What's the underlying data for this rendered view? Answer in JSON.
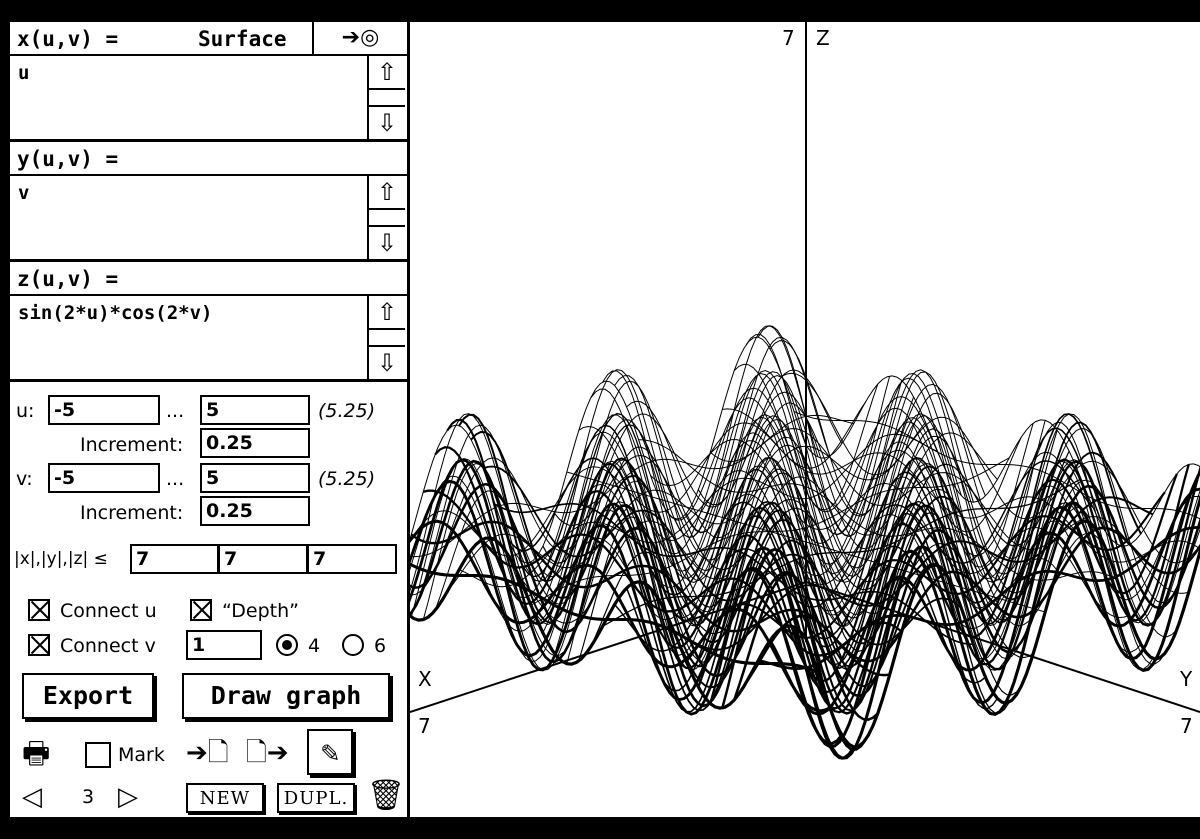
{
  "panel": {
    "x_label": "x(u,v) =",
    "mode_label": "Surface",
    "mode_button": "➔◎",
    "x_expr": "u",
    "y_label": "y(u,v) =",
    "y_expr": "v",
    "z_label": "z(u,v) =",
    "z_expr": "sin(2*u)*cos(2*v)",
    "u_label": "u:",
    "u_min": "-5",
    "u_max": "5",
    "u_note": "(5.25)",
    "u_inc_label": "Increment:",
    "u_inc": "0.25",
    "v_label": "v:",
    "v_min": "-5",
    "v_max": "5",
    "v_note": "(5.25)",
    "v_inc_label": "Increment:",
    "v_inc": "0.25",
    "ellipsis": "...",
    "bounds_label": "|x|,|y|,|z| ≤",
    "bound_x": "7",
    "bound_y": "7",
    "bound_z": "7",
    "connect_u": "Connect u",
    "depth": "“Depth”",
    "connect_v": "Connect v",
    "depth_value": "1",
    "radio_4": "4",
    "radio_6": "6",
    "export": "Export",
    "draw": "Draw graph",
    "mark": "Mark",
    "page": "3",
    "new": "NEW",
    "dupl": "DUPL."
  },
  "plot": {
    "z_axis_label": "Z",
    "z_tick": "7",
    "x_axis_label": "X",
    "x_tick": "7",
    "y_axis_label": "Y",
    "y_tick": "7"
  },
  "colors": {
    "background": "#000000",
    "paper": "#ffffff",
    "ink": "#000000"
  }
}
